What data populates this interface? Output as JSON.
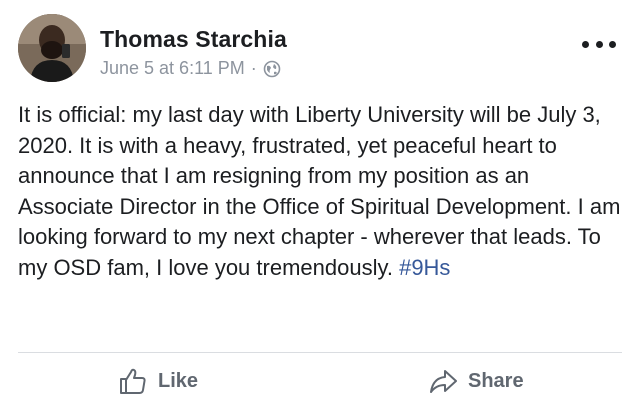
{
  "post": {
    "author": "Thomas Starchia",
    "timestamp": "June 5 at 6:11 PM",
    "separator": "·",
    "privacy_icon": "globe-icon",
    "menu_icon": "more-options-icon",
    "body": "It is official: my last day with Liberty University will be July 3, 2020. It is with a heavy, frustrated, yet peaceful heart to announce that I am resigning from my position as an Associate Director in the Office of Spiritual Development. I am looking forward to my next chapter - wherever that leads. To my OSD fam, I love you tremendously.",
    "hashtag": "#9Hs"
  },
  "actions": {
    "like_label": "Like",
    "like_icon": "thumbs-up-icon",
    "share_label": "Share",
    "share_icon": "share-arrow-icon"
  },
  "colors": {
    "text": "#1c1e21",
    "meta": "#8d949e",
    "link": "#365899",
    "action": "#606770",
    "divider": "#dadde1"
  }
}
